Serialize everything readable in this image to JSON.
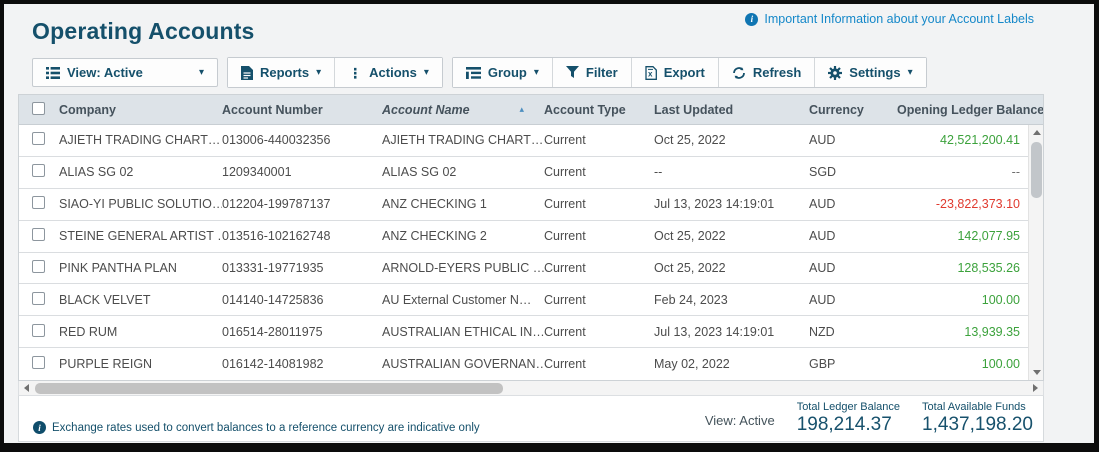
{
  "page": {
    "title": "Operating Accounts",
    "info_link": "Important Information about your Account Labels"
  },
  "toolbar": {
    "view": "View: Active",
    "reports": "Reports",
    "actions": "Actions",
    "group": "Group",
    "filter": "Filter",
    "export": "Export",
    "refresh": "Refresh",
    "settings": "Settings"
  },
  "table": {
    "columns": [
      "Company",
      "Account Number",
      "Account Name",
      "Account Type",
      "Last Updated",
      "Currency",
      "Opening Ledger Balance"
    ],
    "sorted_column": "Account Name",
    "sort_direction": "asc",
    "sort_icon": "▴",
    "rows": [
      {
        "company": "AJIETH TRADING CHART…",
        "account_number": "013006-440032356",
        "account_name": "AJIETH TRADING CHART…",
        "account_type": "Current",
        "last_updated": "Oct 25, 2022",
        "currency": "AUD",
        "opening_ledger_balance": "42,521,200.41"
      },
      {
        "company": "ALIAS SG 02",
        "account_number": "1209340001",
        "account_name": "ALIAS SG 02",
        "account_type": "Current",
        "last_updated": "--",
        "currency": "SGD",
        "opening_ledger_balance": "--"
      },
      {
        "company": "SIAO-YI PUBLIC SOLUTIO…",
        "account_number": "012204-199787137",
        "account_name": "ANZ CHECKING 1",
        "account_type": "Current",
        "last_updated": "Jul 13, 2023 14:19:01",
        "currency": "AUD",
        "opening_ledger_balance": "-23,822,373.10"
      },
      {
        "company": "STEINE GENERAL ARTIST …",
        "account_number": "013516-102162748",
        "account_name": "ANZ CHECKING 2",
        "account_type": "Current",
        "last_updated": "Oct 25, 2022",
        "currency": "AUD",
        "opening_ledger_balance": "142,077.95"
      },
      {
        "company": "PINK PANTHA PLAN",
        "account_number": "013331-19771935",
        "account_name": "ARNOLD-EYERS PUBLIC …",
        "account_type": "Current",
        "last_updated": "Oct 25, 2022",
        "currency": "AUD",
        "opening_ledger_balance": "128,535.26"
      },
      {
        "company": "BLACK VELVET",
        "account_number": "014140-14725836",
        "account_name": "AU External Customer N…",
        "account_type": "Current",
        "last_updated": "Feb 24, 2023",
        "currency": "AUD",
        "opening_ledger_balance": "100.00"
      },
      {
        "company": "RED RUM",
        "account_number": "016514-28011975",
        "account_name": "AUSTRALIAN ETHICAL IN…",
        "account_type": "Current",
        "last_updated": "Jul 13, 2023 14:19:01",
        "currency": "NZD",
        "opening_ledger_balance": "13,939.35"
      },
      {
        "company": "PURPLE REIGN",
        "account_number": "016142-14081982",
        "account_name": "AUSTRALIAN GOVERNAN…",
        "account_type": "Current",
        "last_updated": "May 02, 2022",
        "currency": "GBP",
        "opening_ledger_balance": "100.00"
      }
    ]
  },
  "footer": {
    "note": "Exchange rates used to convert balances to a reference currency are indicative only",
    "view_label": "View: Active",
    "total_ledger_balance_label": "Total Ledger Balance",
    "total_ledger_balance": "198,214.37",
    "total_available_funds_label": "Total Available Funds",
    "total_available_funds": "1,437,198.20"
  },
  "colors": {
    "accent_navy": "#15506b",
    "link_blue": "#1588c9",
    "positive_green": "#3ca23c",
    "negative_red": "#e03a2f",
    "header_bg": "#dde3e8"
  }
}
